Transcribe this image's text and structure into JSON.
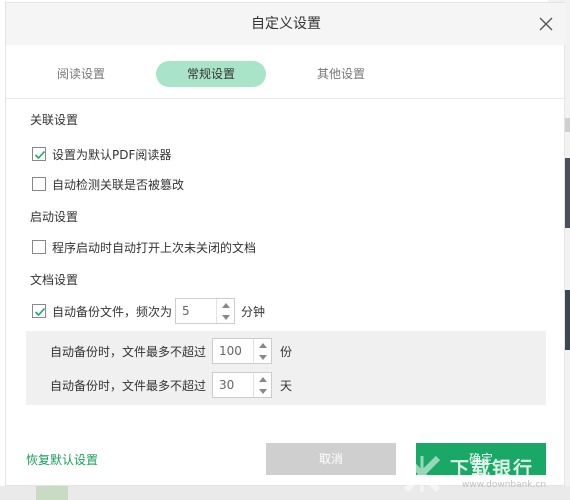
{
  "dialog": {
    "title": "自定义设置"
  },
  "tabs": [
    {
      "label": "阅读设置",
      "active": false
    },
    {
      "label": "常规设置",
      "active": true
    },
    {
      "label": "其他设置",
      "active": false
    }
  ],
  "association": {
    "title": "关联设置",
    "default_pdf_reader": {
      "label": "设置为默认PDF阅读器",
      "checked": true
    },
    "detect_tampered": {
      "label": "自动检测关联是否被篡改",
      "checked": false
    }
  },
  "startup": {
    "title": "启动设置",
    "open_last_docs": {
      "label": "程序启动时自动打开上次未关闭的文档",
      "checked": false
    }
  },
  "document": {
    "title": "文档设置",
    "auto_backup": {
      "label": "自动备份文件，频次为",
      "checked": true,
      "interval_value": "5",
      "interval_unit": "分钟"
    },
    "backup_max_files": {
      "label": "自动备份时，文件最多不超过",
      "value": "100",
      "unit": "份"
    },
    "backup_max_days": {
      "label": "自动备份时，文件最多不超过",
      "value": "30",
      "unit": "天"
    }
  },
  "footer": {
    "reset_label": "恢复默认设置",
    "cancel_label": "取消",
    "ok_label": "确定"
  },
  "watermark": {
    "text": "下载银行",
    "url": "www.downbank.cn"
  },
  "colors": {
    "accent": "#19a866",
    "tab_active_bg": "#a9e4c8",
    "cancel_bg": "#cfcfcf",
    "link": "#19a05a"
  },
  "icons": {
    "close": "close-icon",
    "check": "check-icon",
    "spin_up": "caret-up-icon",
    "spin_down": "caret-down-icon"
  }
}
